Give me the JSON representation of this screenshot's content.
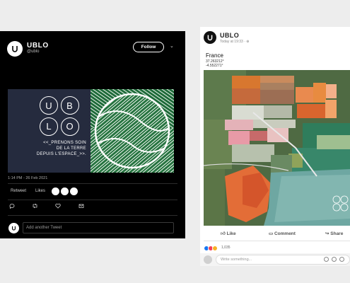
{
  "twitter": {
    "name": "UBLO",
    "handle": "@ublo",
    "follow_label": "Follow",
    "logo_letters": [
      "U",
      "B",
      "L",
      "O"
    ],
    "slogan_line1": "<<_PRENONS SOIN",
    "slogan_line2": "DE LA TERRE",
    "slogan_line3": "DEPUIS L'ESPACE_>>.",
    "timestamp": "1:14 PM - 26 Feb 2021",
    "retweet_label": "Retweet",
    "likes_label": "Likes",
    "reply_placeholder": "Add another Tweet"
  },
  "facebook": {
    "name": "UBLO",
    "time": "Today at 19:33 · ",
    "place": "France",
    "coord_lat": "37.263212°",
    "coord_lon": "-4.552271°",
    "like_label": "Like",
    "comment_label": "Comment",
    "share_label": "Share",
    "reaction_count": "1,035",
    "comment_placeholder": "Write something..."
  },
  "colors": {
    "fb_like": "#1877f2",
    "fb_love": "#f33e58",
    "fb_wow": "#f7b125"
  }
}
